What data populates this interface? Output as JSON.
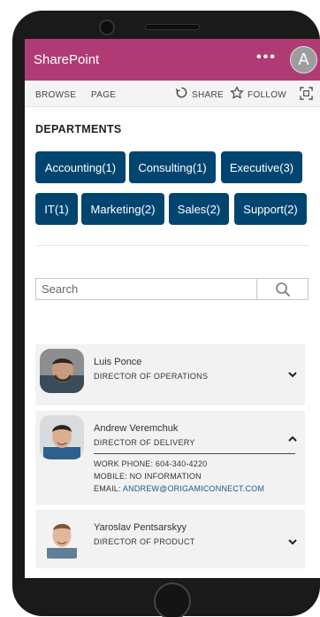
{
  "app": {
    "title": "SharePoint",
    "more_label": "•••",
    "avatar_initial": "A"
  },
  "ribbon": {
    "browse": "BROWSE",
    "page": "PAGE",
    "share": "SHARE",
    "follow": "FOLLOW"
  },
  "departments": {
    "heading": "DEPARTMENTS",
    "items": [
      {
        "label": "Accounting(1)"
      },
      {
        "label": "Consulting(1)"
      },
      {
        "label": "Executive(3)"
      },
      {
        "label": "IT(1)"
      },
      {
        "label": "Marketing(2)"
      },
      {
        "label": "Sales(2)"
      },
      {
        "label": "Support(2)"
      }
    ]
  },
  "search": {
    "placeholder": "Search"
  },
  "people": [
    {
      "name": "Luis Ponce",
      "title": "DIRECTOR OF OPERATIONS",
      "expanded": false
    },
    {
      "name": "Andrew Veremchuk",
      "title": "DIRECTOR OF DELIVERY",
      "expanded": true,
      "work_phone": "WORK PHONE: 604-340-4220",
      "mobile": "MOBILE: NO INFORMATION",
      "email_label": "EMAIL: ",
      "email": "ANDREW@ORIGAMICONNECT.COM"
    },
    {
      "name": "Yaroslav Pentsarskyy",
      "title": "DIRECTOR OF PRODUCT",
      "expanded": false
    }
  ],
  "colors": {
    "suitebar": "#b03b74",
    "department_button": "#004570",
    "card_background": "#f2f2f2"
  }
}
